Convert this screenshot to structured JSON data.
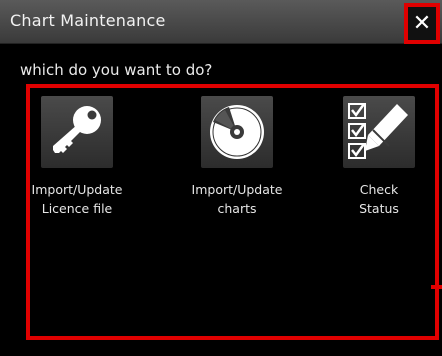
{
  "window": {
    "title": "Chart Maintenance"
  },
  "controls": {
    "close_glyph": "✕"
  },
  "prompt": "which do you want to do?",
  "options": [
    {
      "label": "Import/Update\nLicence file",
      "icon": "key-icon"
    },
    {
      "label": "Import/Update\ncharts",
      "icon": "disc-icon"
    },
    {
      "label": "Check\nStatus",
      "icon": "checklist-pencil-icon"
    }
  ],
  "colors": {
    "highlight": "#e00000",
    "background": "#000000",
    "titlebar": "#4a4a4a"
  }
}
